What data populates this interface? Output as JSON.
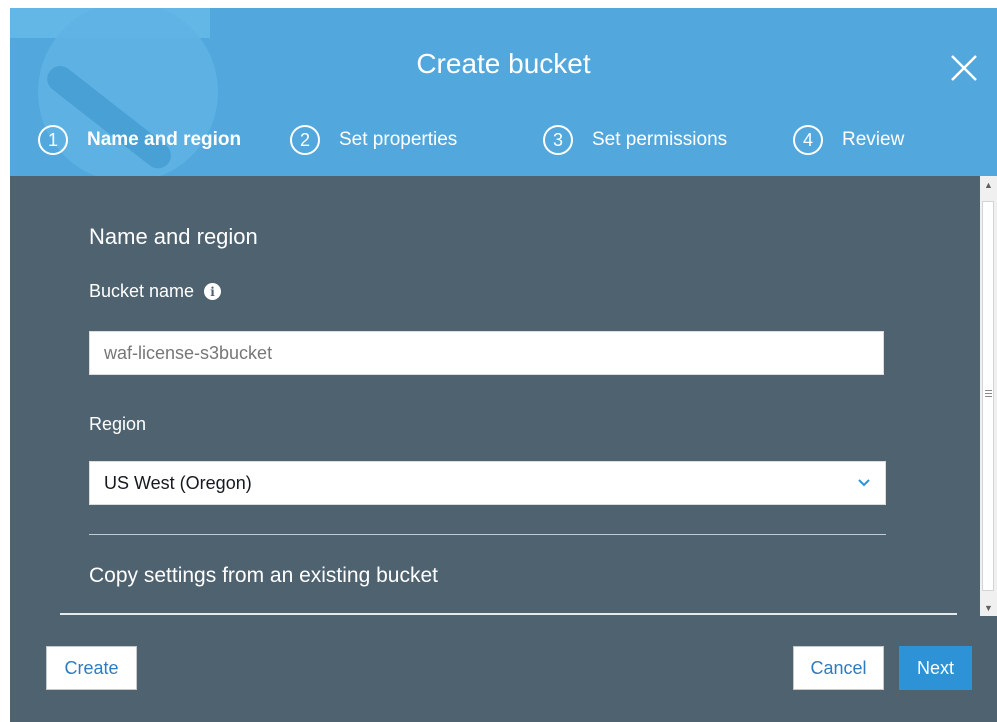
{
  "dialog": {
    "title": "Create bucket"
  },
  "steps": [
    {
      "number": "1",
      "label": "Name and region",
      "active": true
    },
    {
      "number": "2",
      "label": "Set properties",
      "active": false
    },
    {
      "number": "3",
      "label": "Set permissions",
      "active": false
    },
    {
      "number": "4",
      "label": "Review",
      "active": false
    }
  ],
  "form": {
    "section_title": "Name and region",
    "bucket_name_label": "Bucket name",
    "bucket_name_value": "waf-license-s3bucket",
    "region_label": "Region",
    "region_value": "US West (Oregon)",
    "copy_settings_label": "Copy settings from an existing bucket"
  },
  "footer": {
    "create_label": "Create",
    "cancel_label": "Cancel",
    "next_label": "Next"
  },
  "colors": {
    "header": "#52a8dc",
    "body": "#4f6270",
    "primary_button": "#2e93d6",
    "link_text": "#2f7bbf"
  },
  "icons": [
    "close-icon",
    "info-icon",
    "chevron-down-icon",
    "scroll-up-arrow-icon",
    "scroll-down-arrow-icon"
  ]
}
